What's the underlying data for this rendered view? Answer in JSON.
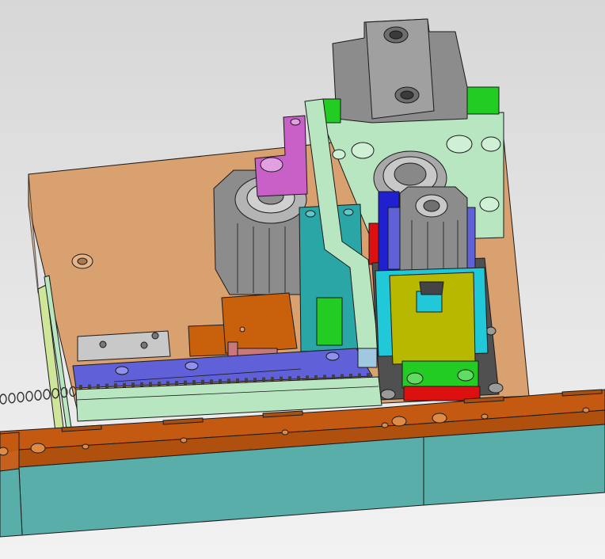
{
  "scene": {
    "type": "3D CAD model viewport",
    "colors": {
      "background_top": "#d7d7d7",
      "background_bottom": "#f2f2f2",
      "base_plate": "#d9a070",
      "rail": "#c45a12",
      "foot": "#5aaeaa",
      "gray_part": "#8c8c8c",
      "mint_part": "#b8e6c0",
      "teal_part": "#2aa6a6",
      "blue_part": "#2020d0",
      "violet_part": "#6060d8",
      "yellow_part": "#b8b800",
      "cyan_part": "#20c8d8",
      "green_part": "#22cc22",
      "red_part": "#dd1010",
      "magenta_part": "#c860c8",
      "orange_part": "#c8600c",
      "silver_part": "#c8c8c8"
    }
  }
}
